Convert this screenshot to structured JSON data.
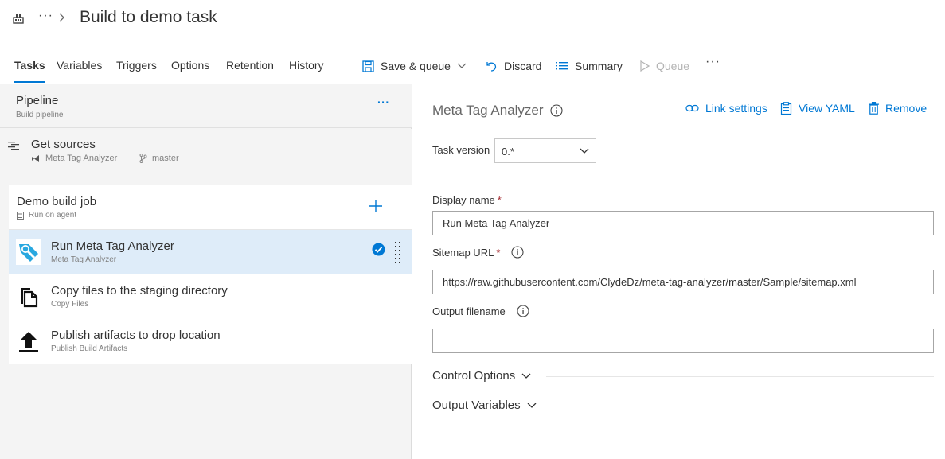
{
  "header": {
    "breadcrumb_more": "···",
    "title": "Build to demo task"
  },
  "tabs": [
    {
      "label": "Tasks",
      "active": true
    },
    {
      "label": "Variables"
    },
    {
      "label": "Triggers"
    },
    {
      "label": "Options"
    },
    {
      "label": "Retention"
    },
    {
      "label": "History"
    }
  ],
  "toolbar": {
    "save_queue": "Save & queue",
    "discard": "Discard",
    "summary": "Summary",
    "queue": "Queue",
    "more": "···"
  },
  "pipeline": {
    "title": "Pipeline",
    "subtitle": "Build pipeline",
    "more": "···"
  },
  "sources": {
    "title": "Get sources",
    "repo": "Meta Tag Analyzer",
    "branch": "master"
  },
  "job": {
    "title": "Demo build job",
    "subtitle": "Run on agent"
  },
  "tasks": [
    {
      "title": "Run Meta Tag Analyzer",
      "subtitle": "Meta Tag Analyzer",
      "selected": true
    },
    {
      "title": "Copy files to the staging directory",
      "subtitle": "Copy Files"
    },
    {
      "title": "Publish artifacts to drop location",
      "subtitle": "Publish Build Artifacts"
    }
  ],
  "detail": {
    "title": "Meta Tag Analyzer",
    "link_settings": "Link settings",
    "view_yaml": "View YAML",
    "remove": "Remove",
    "task_version_label": "Task version",
    "task_version_value": "0.*",
    "display_name_label": "Display name",
    "display_name_value": "Run Meta Tag Analyzer",
    "sitemap_label": "Sitemap URL",
    "sitemap_value": "https://raw.githubusercontent.com/ClydeDz/meta-tag-analyzer/master/Sample/sitemap.xml",
    "output_label": "Output filename",
    "output_value": "",
    "required_mark": "*",
    "control_options": "Control Options",
    "output_variables": "Output Variables"
  },
  "colors": {
    "accent": "#0078d4",
    "selected_bg": "#deecf9",
    "required": "#a4262c"
  }
}
